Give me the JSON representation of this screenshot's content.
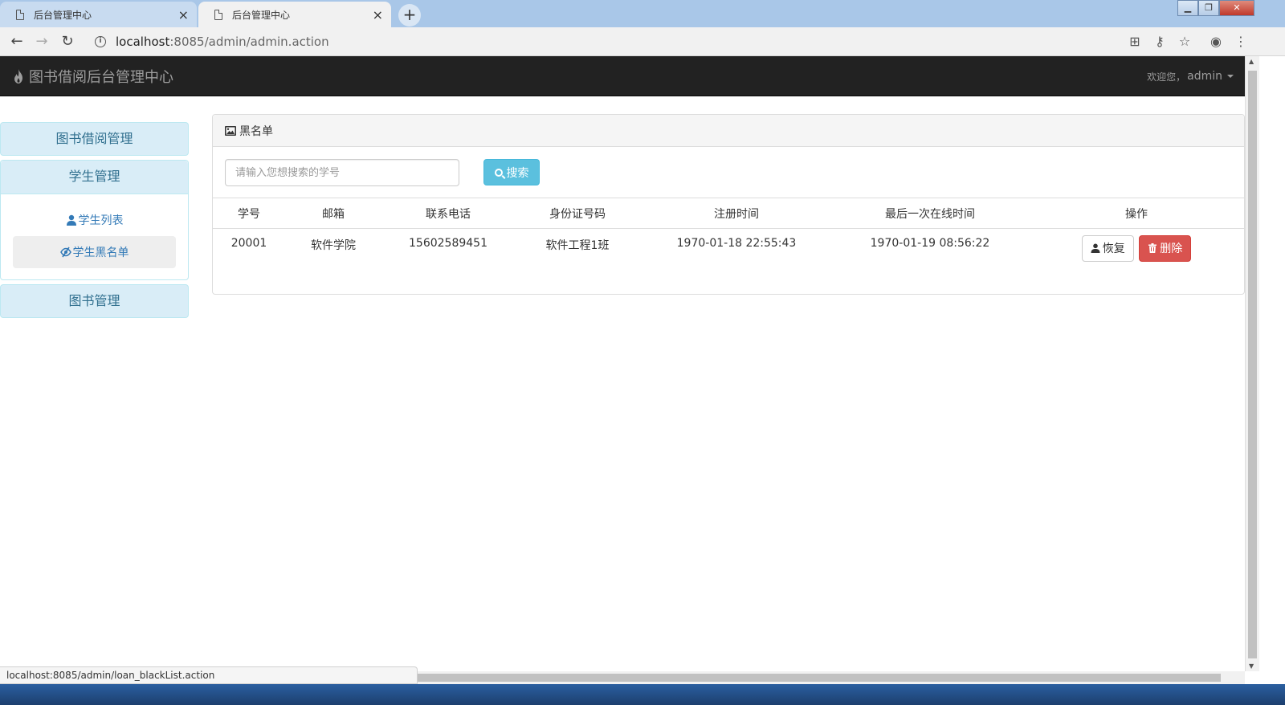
{
  "browser": {
    "tabs": [
      {
        "title": "后台管理中心",
        "active": false
      },
      {
        "title": "后台管理中心",
        "active": true
      }
    ],
    "url_host": "localhost",
    "url_rest": ":8085/admin/admin.action",
    "status_url": "localhost:8085/admin/loan_blackList.action"
  },
  "navbar": {
    "brand": "图书借阅后台管理中心",
    "welcome_prefix": "欢迎您，",
    "username": "admin"
  },
  "sidebar": {
    "groups": [
      {
        "label": "图书借阅管理"
      },
      {
        "label": "学生管理",
        "items": [
          {
            "label": "学生列表",
            "active": false
          },
          {
            "label": "学生黑名单",
            "active": true
          }
        ]
      },
      {
        "label": "图书管理"
      }
    ]
  },
  "panel": {
    "title": "黑名单",
    "search_placeholder": "请输入您想搜索的学号",
    "search_button": "搜索",
    "columns": [
      "学号",
      "邮箱",
      "联系电话",
      "身份证号码",
      "注册时间",
      "最后一次在线时间",
      "操作"
    ],
    "rows": [
      {
        "id": "20001",
        "email": "软件学院",
        "phone": "15602589451",
        "idcard": "软件工程1班",
        "registered": "1970-01-18 22:55:43",
        "last_online": "1970-01-19 08:56:22",
        "restore_label": "恢复",
        "delete_label": "删除"
      }
    ]
  },
  "colors": {
    "navbar_bg": "#222222",
    "sidebar_head_bg": "#d9edf7",
    "info_button": "#5bc0de",
    "danger_button": "#d9534f"
  }
}
